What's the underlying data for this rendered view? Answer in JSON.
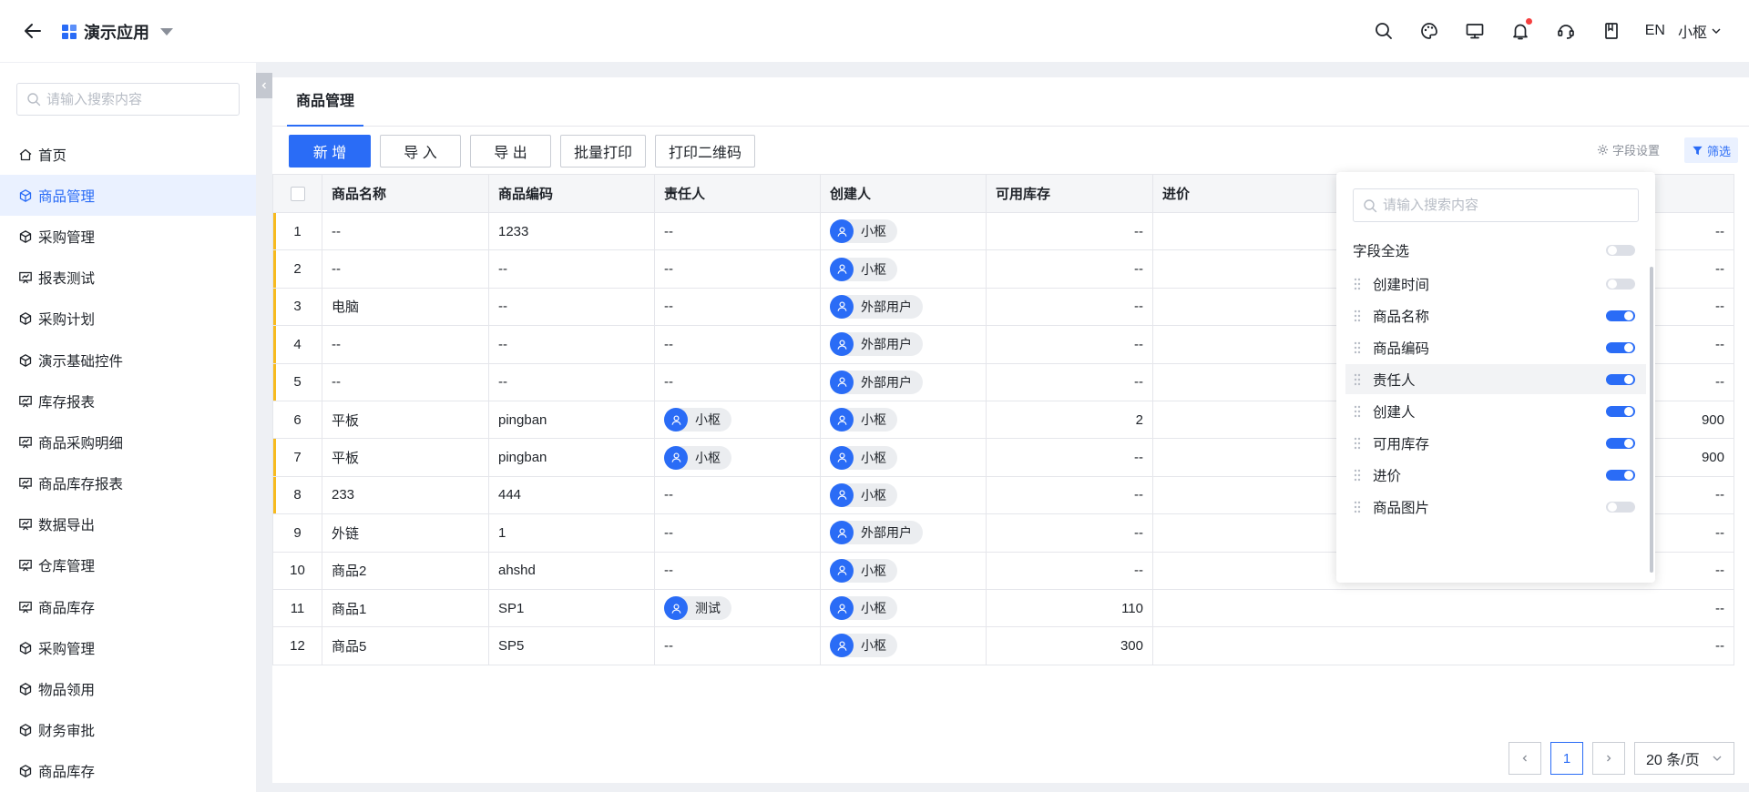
{
  "header": {
    "app_title": "演示应用",
    "lang": "EN",
    "user": "小枢",
    "icons": [
      "search-icon",
      "palette-icon",
      "monitor-icon",
      "bell-icon",
      "headset-icon",
      "book-icon"
    ],
    "accent": "#2a6cf6"
  },
  "sidebar": {
    "search_placeholder": "请输入搜索内容",
    "items": [
      {
        "label": "首页",
        "icon": "home-icon"
      },
      {
        "label": "商品管理",
        "icon": "cube-icon",
        "active": true
      },
      {
        "label": "采购管理",
        "icon": "cube-icon"
      },
      {
        "label": "报表测试",
        "icon": "chart-board-icon"
      },
      {
        "label": "采购计划",
        "icon": "cube-icon"
      },
      {
        "label": "演示基础控件",
        "icon": "cube-icon"
      },
      {
        "label": "库存报表",
        "icon": "chart-board-icon"
      },
      {
        "label": "商品采购明细",
        "icon": "chart-board-icon"
      },
      {
        "label": "商品库存报表",
        "icon": "chart-board-icon"
      },
      {
        "label": "数据导出",
        "icon": "chart-board-icon"
      },
      {
        "label": "仓库管理",
        "icon": "chart-board-icon"
      },
      {
        "label": "商品库存",
        "icon": "chart-board-icon"
      },
      {
        "label": "采购管理",
        "icon": "cube-icon"
      },
      {
        "label": "物品领用",
        "icon": "cube-icon"
      },
      {
        "label": "财务审批",
        "icon": "cube-icon"
      },
      {
        "label": "商品库存",
        "icon": "cube-icon"
      }
    ]
  },
  "main": {
    "tab": "商品管理",
    "toolbar": {
      "add": "新 增",
      "import": "导 入",
      "export": "导 出",
      "batch_print": "批量打印",
      "print_qr": "打印二维码",
      "field_settings": "字段设置",
      "filter": "筛选"
    },
    "table": {
      "columns": [
        "商品名称",
        "商品编码",
        "责任人",
        "创建人",
        "可用库存",
        "进价"
      ],
      "rows": [
        {
          "idx": "1",
          "flag": true,
          "name": "--",
          "code": "1233",
          "owner": "--",
          "creator": "小枢",
          "stock": "--",
          "price": "--"
        },
        {
          "idx": "2",
          "flag": true,
          "name": "--",
          "code": "--",
          "owner": "--",
          "creator": "小枢",
          "stock": "--",
          "price": "--"
        },
        {
          "idx": "3",
          "flag": true,
          "name": "电脑",
          "code": "--",
          "owner": "--",
          "creator": "外部用户",
          "stock": "--",
          "price": "--"
        },
        {
          "idx": "4",
          "flag": true,
          "name": "--",
          "code": "--",
          "owner": "--",
          "creator": "外部用户",
          "stock": "--",
          "price": "--"
        },
        {
          "idx": "5",
          "flag": true,
          "name": "--",
          "code": "--",
          "owner": "--",
          "creator": "外部用户",
          "stock": "--",
          "price": "--"
        },
        {
          "idx": "6",
          "flag": false,
          "name": "平板",
          "code": "pingban",
          "owner": "小枢",
          "creator": "小枢",
          "stock": "2",
          "price": "900"
        },
        {
          "idx": "7",
          "flag": true,
          "name": "平板",
          "code": "pingban",
          "owner": "小枢",
          "creator": "小枢",
          "stock": "--",
          "price": "900"
        },
        {
          "idx": "8",
          "flag": true,
          "name": "233",
          "code": "444",
          "owner": "--",
          "creator": "小枢",
          "stock": "--",
          "price": "--"
        },
        {
          "idx": "9",
          "flag": false,
          "name": "外链",
          "code": "1",
          "owner": "--",
          "creator": "外部用户",
          "stock": "--",
          "price": "--"
        },
        {
          "idx": "10",
          "flag": false,
          "name": "商品2",
          "code": "ahshd",
          "owner": "--",
          "creator": "小枢",
          "stock": "--",
          "price": "--"
        },
        {
          "idx": "11",
          "flag": false,
          "name": "商品1",
          "code": "SP1",
          "owner": "测试",
          "creator": "小枢",
          "stock": "110",
          "price": "--"
        },
        {
          "idx": "12",
          "flag": false,
          "name": "商品5",
          "code": "SP5",
          "owner": "--",
          "creator": "小枢",
          "stock": "300",
          "price": "--"
        }
      ],
      "row_flag_color": "#f7ba1e"
    },
    "pager": {
      "current": "1",
      "size": "20 条/页"
    }
  },
  "field_popover": {
    "search_placeholder": "请输入搜索内容",
    "select_all_label": "字段全选",
    "select_all_on": false,
    "fields": [
      {
        "label": "创建时间",
        "on": false
      },
      {
        "label": "商品名称",
        "on": true
      },
      {
        "label": "商品编码",
        "on": true
      },
      {
        "label": "责任人",
        "on": true
      },
      {
        "label": "创建人",
        "on": true
      },
      {
        "label": "可用库存",
        "on": true
      },
      {
        "label": "进价",
        "on": true
      },
      {
        "label": "商品图片",
        "on": false
      }
    ]
  }
}
